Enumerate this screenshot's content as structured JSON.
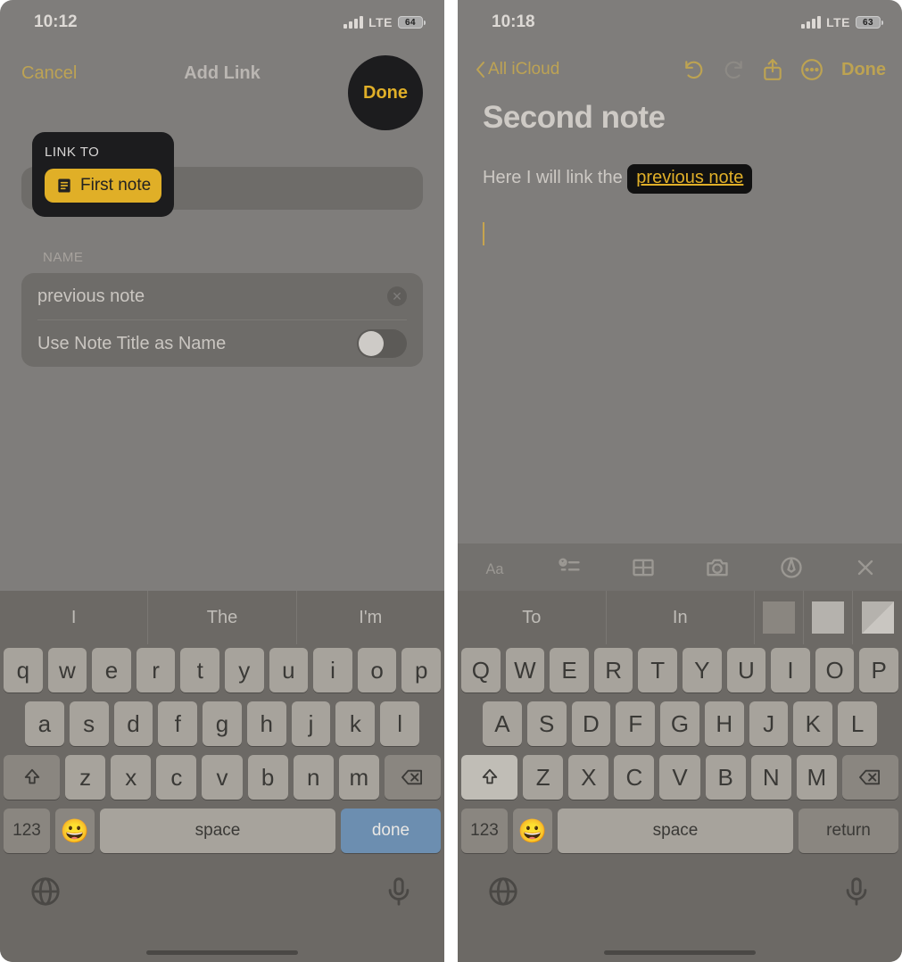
{
  "left": {
    "status": {
      "time": "10:12",
      "net": "LTE",
      "batt": "64"
    },
    "nav": {
      "cancel": "Cancel",
      "title": "Add Link",
      "done": "Done"
    },
    "linkto": {
      "label": "LINK TO",
      "chip": "First note"
    },
    "name": {
      "label": "NAME",
      "value": "previous note",
      "toggle_label": "Use Note Title as Name"
    },
    "suggestions": [
      "I",
      "The",
      "I'm"
    ],
    "keys": {
      "r1": [
        "q",
        "w",
        "e",
        "r",
        "t",
        "y",
        "u",
        "i",
        "o",
        "p"
      ],
      "r2": [
        "a",
        "s",
        "d",
        "f",
        "g",
        "h",
        "j",
        "k",
        "l"
      ],
      "r3": [
        "z",
        "x",
        "c",
        "v",
        "b",
        "n",
        "m"
      ],
      "num": "123",
      "space": "space",
      "action": "done"
    }
  },
  "right": {
    "status": {
      "time": "10:18",
      "net": "LTE",
      "batt": "63"
    },
    "nav": {
      "back": "All iCloud",
      "done": "Done"
    },
    "note": {
      "title": "Second note",
      "body_prefix": "Here I will link the ",
      "link_text": "previous note"
    },
    "suggestions": [
      "To",
      "In"
    ],
    "keys": {
      "r1": [
        "Q",
        "W",
        "E",
        "R",
        "T",
        "Y",
        "U",
        "I",
        "O",
        "P"
      ],
      "r2": [
        "A",
        "S",
        "D",
        "F",
        "G",
        "H",
        "J",
        "K",
        "L"
      ],
      "r3": [
        "Z",
        "X",
        "C",
        "V",
        "B",
        "N",
        "M"
      ],
      "num": "123",
      "space": "space",
      "action": "return"
    }
  }
}
